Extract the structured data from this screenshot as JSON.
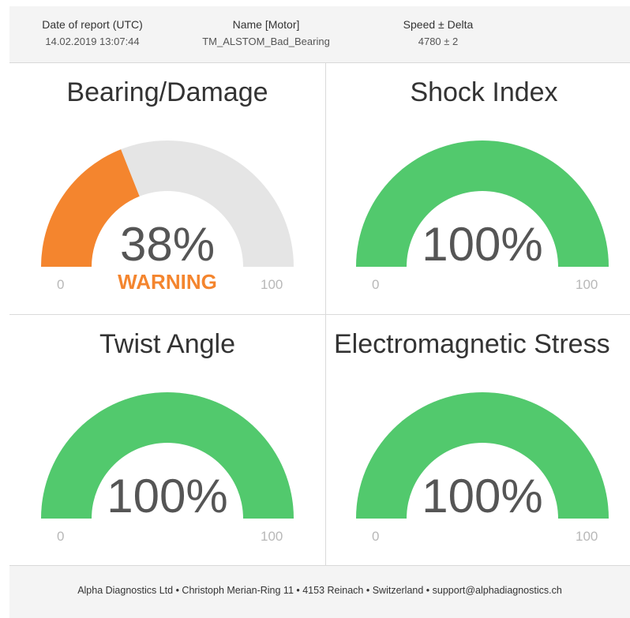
{
  "header": {
    "date_label": "Date of report (UTC)",
    "date_value": "14.02.2019 13:07:44",
    "name_label": "Name [Motor]",
    "name_value": "TM_ALSTOM_Bad_Bearing",
    "speed_label": "Speed ± Delta",
    "speed_value": "4780 ± 2"
  },
  "colors": {
    "warning": "#f4852e",
    "ok": "#52c96d",
    "track": "#e5e5e5"
  },
  "panels": [
    {
      "title": "Bearing/Damage",
      "value_text": "38%",
      "fraction": 0.38,
      "status": "WARNING",
      "color": "#f4852e",
      "min": "0",
      "max": "100"
    },
    {
      "title": "Shock Index",
      "value_text": "100%",
      "fraction": 1.0,
      "status": "",
      "color": "#52c96d",
      "min": "0",
      "max": "100"
    },
    {
      "title": "Twist Angle",
      "value_text": "100%",
      "fraction": 1.0,
      "status": "",
      "color": "#52c96d",
      "min": "0",
      "max": "100"
    },
    {
      "title": "Electromagnetic Stress",
      "value_text": "100%",
      "fraction": 1.0,
      "status": "",
      "color": "#52c96d",
      "min": "0",
      "max": "100"
    }
  ],
  "footer": {
    "text": "Alpha Diagnostics Ltd • Christoph Merian-Ring 11 • 4153 Reinach • Switzerland • support@alphadiagnostics.ch"
  }
}
